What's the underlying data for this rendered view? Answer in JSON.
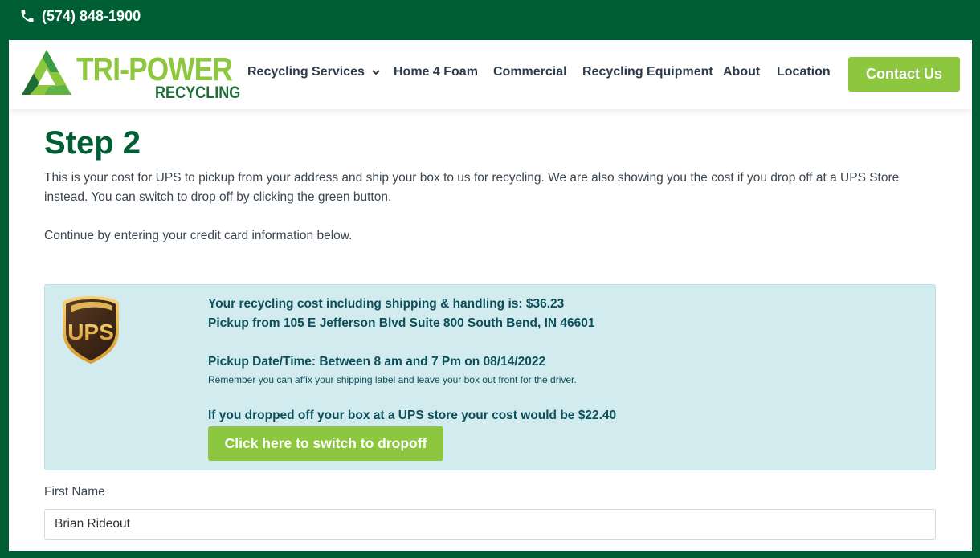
{
  "topbar": {
    "phone": "(574) 848-1900",
    "phone_icon": "phone-icon"
  },
  "logo": {
    "main_text": "TRI-POWER",
    "sub_text": "RECYCLING"
  },
  "nav": {
    "items": [
      {
        "label": "Recycling Services",
        "has_dropdown": true
      },
      {
        "label": "Home 4 Foam"
      },
      {
        "label": "Commercial"
      },
      {
        "label": "Recycling Equipment"
      },
      {
        "label": "About"
      },
      {
        "label": "Location"
      }
    ],
    "contact_label": "Contact Us"
  },
  "content": {
    "title": "Step 2",
    "intro": "This is your cost for UPS to pickup from your address and ship your box to us for recycling. We are also showing you the cost if you drop off at a UPS Store instead. You can switch to drop off by clicking the green button.",
    "continue": "Continue by entering your credit card information below."
  },
  "ups": {
    "logo_text": "UPS",
    "cost_line": "Your recycling cost including shipping & handling is: $36.23",
    "pickup_line": "Pickup from 105 E Jefferson Blvd Suite 800 South Bend, IN 46601",
    "date_line": "Pickup Date/Time: Between 8 am and 7 Pm on 08/14/2022",
    "reminder": "Remember you can affix your shipping label and leave your box out front for the driver.",
    "dropoff_line": "If you dropped off your box at a UPS store your cost would be $22.40",
    "switch_button": "Click here to switch to dropoff"
  },
  "form": {
    "first_name_label": "First Name",
    "first_name_value": "Brian Rideout"
  },
  "colors": {
    "dark_green": "#005e34",
    "accent_green": "#8dc63f",
    "info_bg": "#d2ebef",
    "info_text": "#0c4f5a"
  }
}
